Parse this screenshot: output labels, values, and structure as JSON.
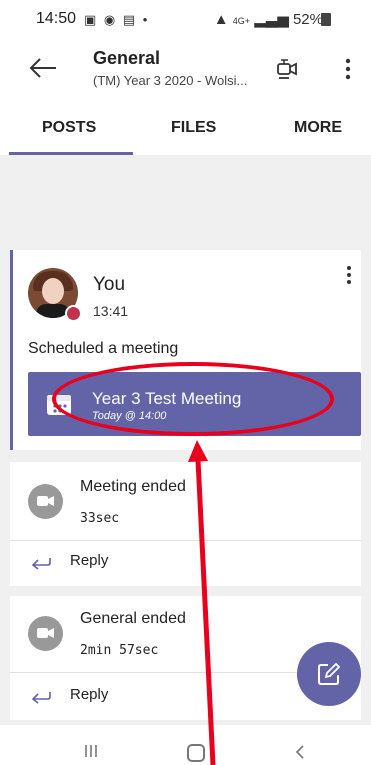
{
  "status_bar": {
    "time": "14:50",
    "signal": "4G+",
    "battery": "52%"
  },
  "header": {
    "title": "General",
    "subtitle": "(TM) Year 3 2020 - Wolsi..."
  },
  "tabs": [
    {
      "label": "POSTS",
      "active": true
    },
    {
      "label": "FILES",
      "active": false
    },
    {
      "label": "MORE",
      "active": false
    }
  ],
  "post": {
    "author": "You",
    "time": "13:41",
    "message": "Scheduled a meeting",
    "meeting": {
      "title": "Year 3 Test Meeting",
      "subtitle": "Today @ 14:00"
    }
  },
  "events": [
    {
      "title": "Meeting ended",
      "duration": "33sec",
      "reply_label": "Reply"
    },
    {
      "title": "General ended",
      "duration": "2min 57sec",
      "reply_label": "Reply"
    }
  ],
  "colors": {
    "accent": "#6264a7",
    "annotation_red": "#e8001c",
    "background_gray": "#f0f0f0"
  },
  "icons": {
    "back": "arrow-left-icon",
    "video": "video-call-icon",
    "more": "more-vertical-icon",
    "calendar": "calendar-icon",
    "event": "video-event-icon",
    "reply": "reply-arrow-icon",
    "compose": "compose-icon"
  }
}
